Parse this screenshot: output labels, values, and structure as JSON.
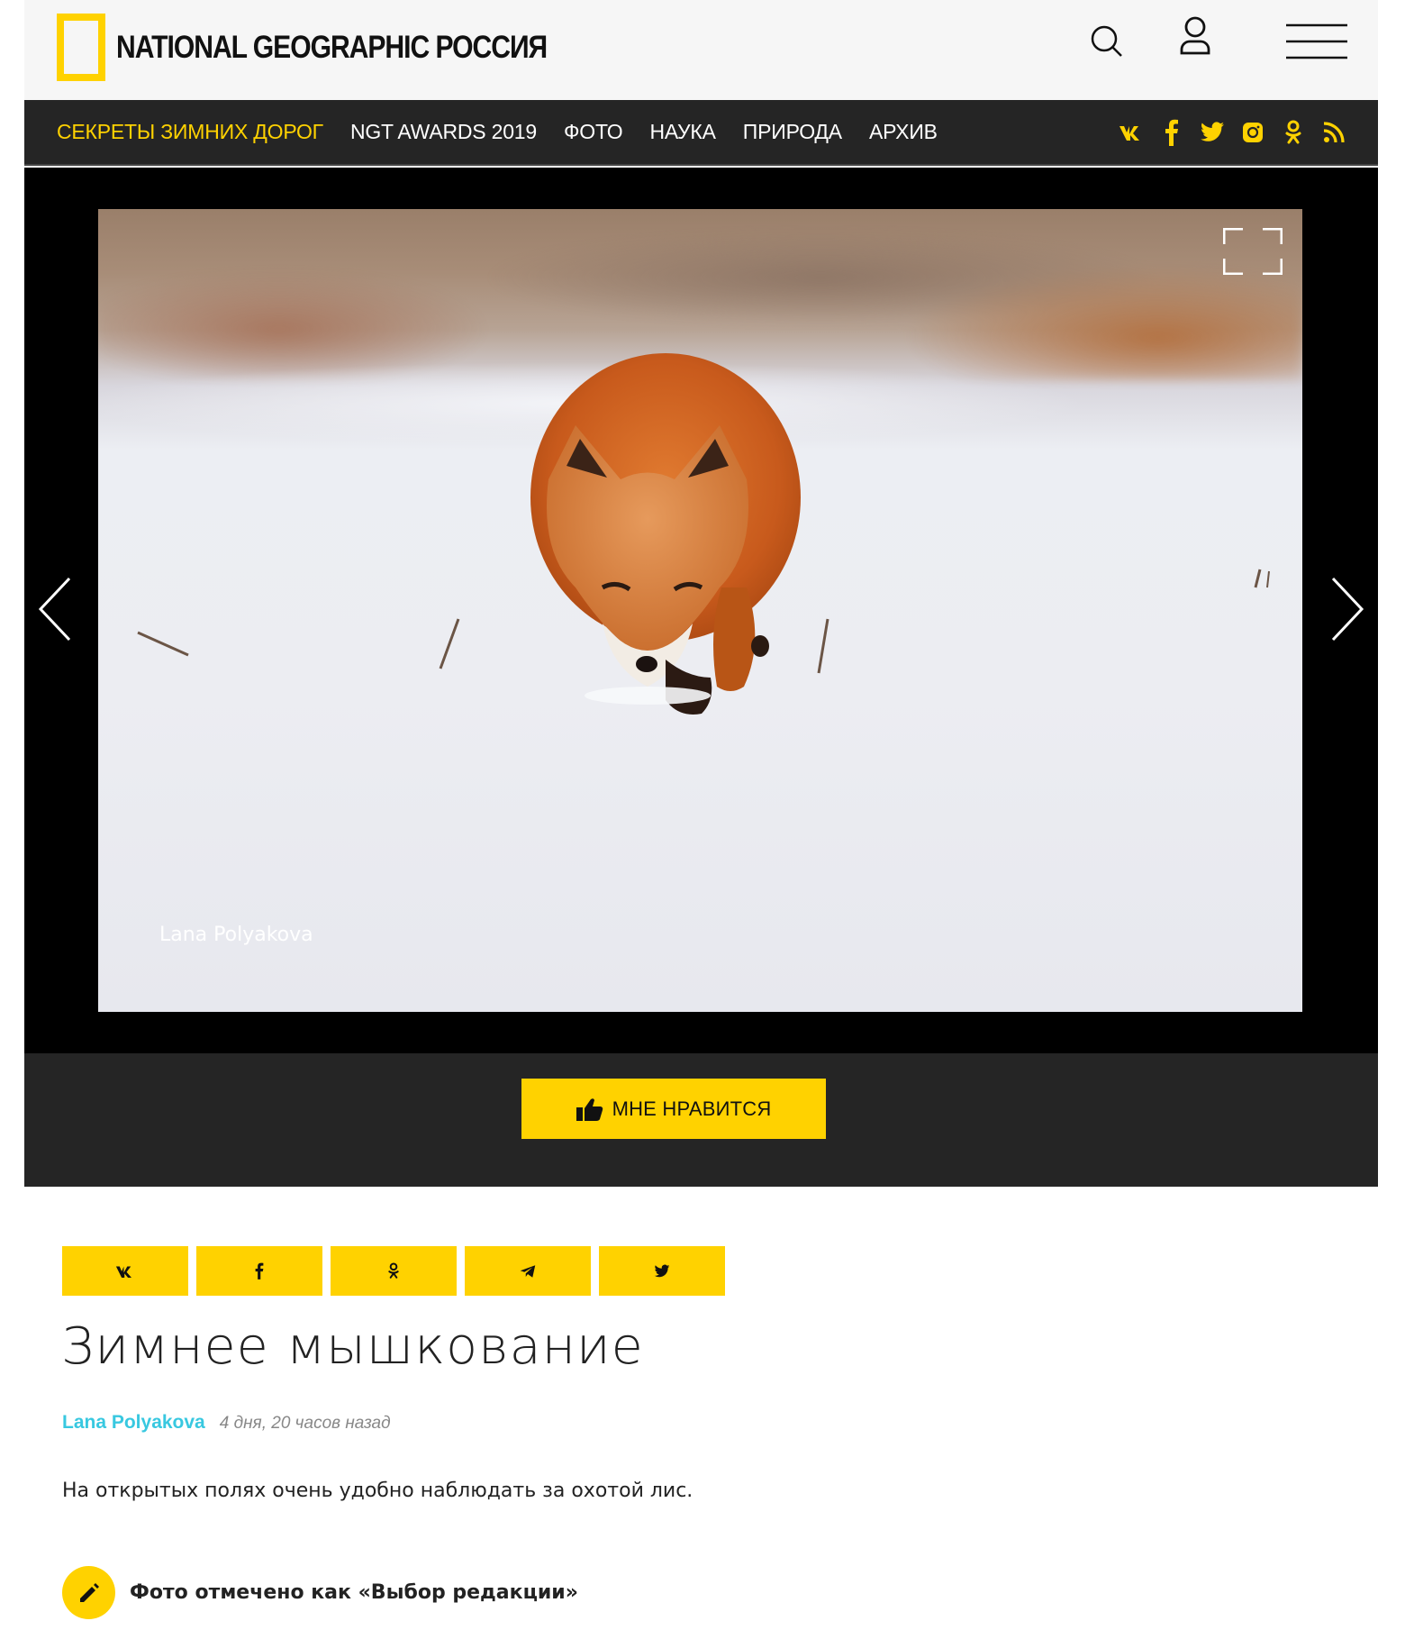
{
  "header": {
    "logo_text": "NATIONAL GEOGRAPHIC РОССИЯ",
    "brand_color": "#ffd200"
  },
  "nav": {
    "items": [
      {
        "label": "СЕКРЕТЫ ЗИМНИХ ДОРОГ",
        "active": true
      },
      {
        "label": "NGT AWARDS 2019"
      },
      {
        "label": "ФОТО"
      },
      {
        "label": "НАУКА"
      },
      {
        "label": "ПРИРОДА"
      },
      {
        "label": "АРХИВ"
      }
    ],
    "socials": [
      "vk-icon",
      "facebook-icon",
      "twitter-icon",
      "instagram-icon",
      "odnoklassniki-icon",
      "rss-icon"
    ]
  },
  "gallery": {
    "caption": "Lana Polyakova"
  },
  "like": {
    "label": "МНЕ НРАВИТСЯ"
  },
  "article": {
    "share_buttons": [
      "vk-icon",
      "facebook-icon",
      "odnoklassniki-icon",
      "telegram-icon",
      "twitter-icon"
    ],
    "title": "Зимнее мышкование",
    "author": "Lana Polyakova",
    "time_ago": "4 дня, 20 часов назад",
    "description": "На открытых полях очень удобно наблюдать за охотой лис.",
    "editors_choice": "Фото отмечено как «Выбор редакции»"
  }
}
